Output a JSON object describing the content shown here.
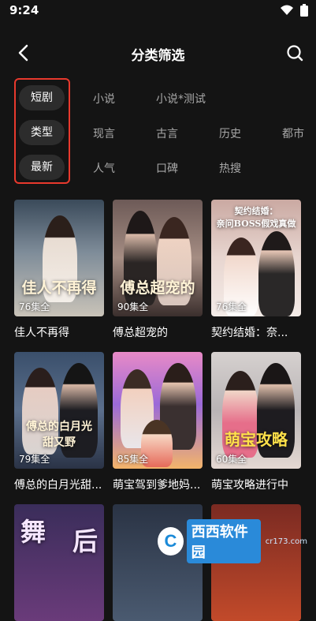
{
  "status": {
    "time": "9:24"
  },
  "header": {
    "title": "分类筛选"
  },
  "filters": {
    "row1": [
      "短剧",
      "小说",
      "小说*测试"
    ],
    "row2": [
      "类型",
      "现言",
      "古言",
      "历史",
      "都市"
    ],
    "row3": [
      "最新",
      "人气",
      "口碑",
      "热搜"
    ]
  },
  "cards": [
    {
      "title": "佳人不再得",
      "episodes": "76集全",
      "art": "佳人不再得"
    },
    {
      "title": "傅总超宠的",
      "episodes": "90集全",
      "art": "傅总超宠的"
    },
    {
      "title": "契约结婚：奈...",
      "episodes": "76集全",
      "art": "契约结婚：\n亲问BOSS假戏真做"
    },
    {
      "title": "傅总的白月光甜...",
      "episodes": "79集全",
      "art": "傅总的白月光\n甜又野"
    },
    {
      "title": "萌宝驾到爹地妈...",
      "episodes": "85集全",
      "art": ""
    },
    {
      "title": "萌宝攻略进行中",
      "episodes": "60集全",
      "art": "萌宝攻略"
    },
    {
      "title": "",
      "episodes": "",
      "art": "舞"
    },
    {
      "title": "",
      "episodes": "",
      "art": "后"
    },
    {
      "title": "",
      "episodes": "",
      "art": ""
    }
  ],
  "watermark": {
    "logo": "C",
    "name": "西西软件园",
    "url": "cr173.com"
  },
  "colors": {
    "accent": "#e8392d",
    "background": "#141414"
  }
}
